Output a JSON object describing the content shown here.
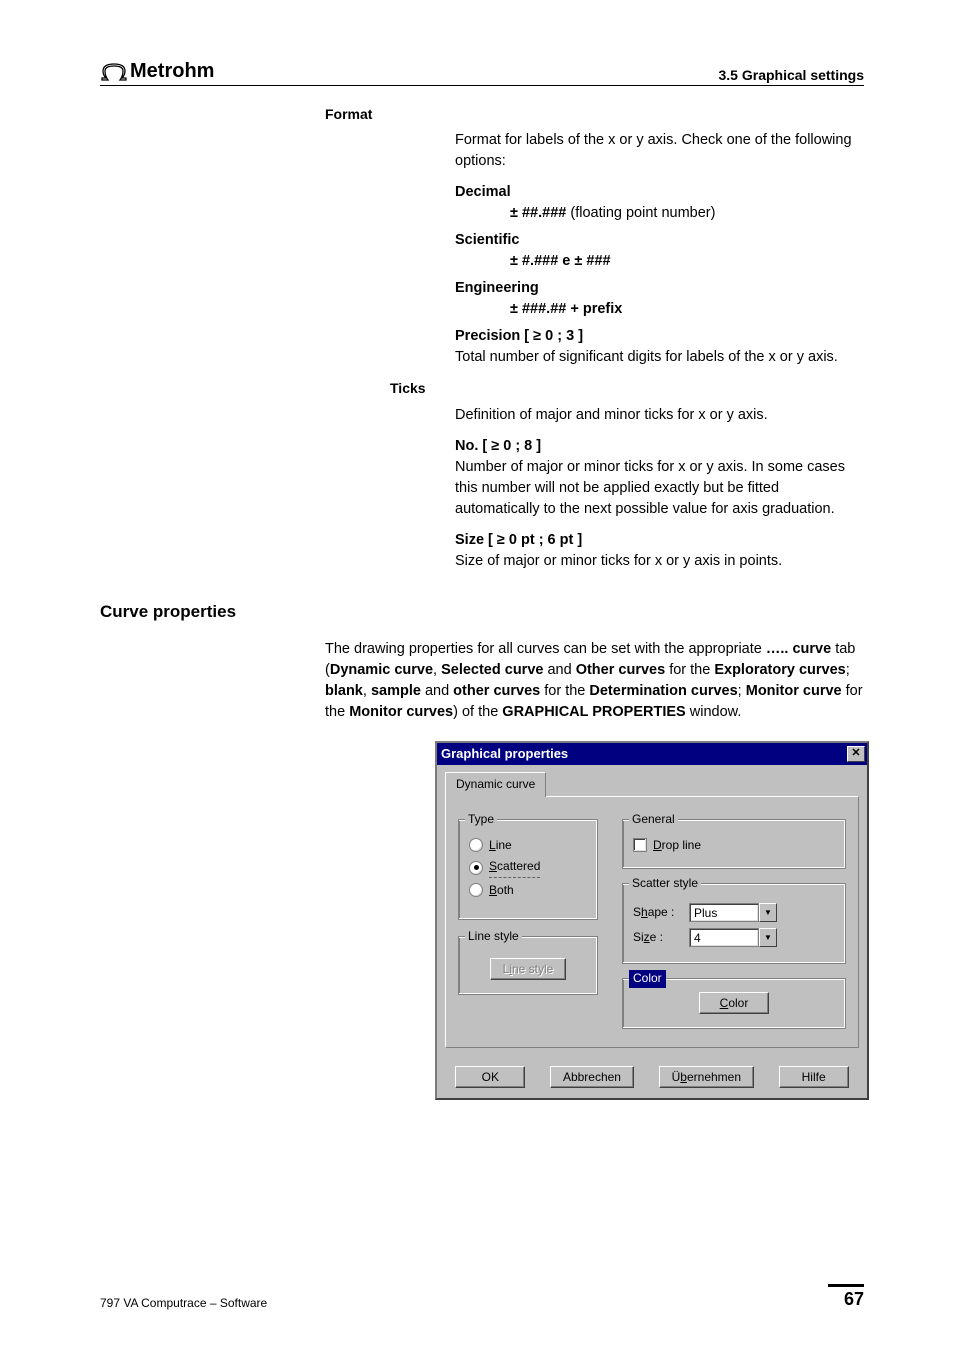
{
  "header": {
    "brand": "Metrohm",
    "section": "3.5  Graphical settings"
  },
  "format": {
    "heading": "Format",
    "intro": "Format for labels of the x or y axis. Check one of the following options:",
    "decimal_label": "Decimal",
    "decimal_fmt": "± ##.### (floating point number)",
    "scientific_label": "Scientific",
    "scientific_fmt": "± #.### e ± ###",
    "engineering_label": "Engineering",
    "engineering_fmt": "± ###.## + prefix",
    "precision_label": "Precision   [ ≥ 0 ; 3 ]",
    "precision_desc": "Total number of significant digits for labels of the x or y axis."
  },
  "ticks": {
    "heading": "Ticks",
    "intro": "Definition of major and minor ticks for x or y axis.",
    "no_label": "No.   [ ≥ 0 ; 8 ]",
    "no_desc": "Number of major or minor ticks for x or y axis. In some cases this number will not be applied exactly but be fitted automatically to the next possible value for axis graduation.",
    "size_label": "Size   [ ≥ 0 pt ; 6 pt ]",
    "size_desc": "Size of major or minor ticks for x or y axis in points."
  },
  "curve": {
    "title": "Curve properties",
    "para_pre": "The drawing properties for all curves can be set with the appropriate ",
    "dots": "…..",
    "curve_word": " curve",
    "tab_word": " tab (",
    "dynamic": "Dynamic curve",
    "sep1": ", ",
    "selected": "Selected curve",
    "and1": " and ",
    "other": "Other curves",
    "for1": " for the ",
    "explor": "Exploratory curves",
    "sep2": "; ",
    "blank": "blank",
    "sep3": ", ",
    "sample": "sample",
    "and2": " and ",
    "other2": "other curves",
    "for2": " for the ",
    "determ": "Determination curves",
    "sep4": "; ",
    "monitor": "Monitor curve",
    "for3": " for the ",
    "monitors": "Monitor curves",
    "close": ") of the ",
    "graphprop": "GRAPHICAL PROPERTIES",
    "window_word": " window."
  },
  "dialog": {
    "title": "Graphical properties",
    "tab": "Dynamic curve",
    "type_legend": "Type",
    "type_line": "Line",
    "type_scattered": "Scattered",
    "type_both": "Both",
    "linestyle_legend": "Line style",
    "linestyle_btn": "Line style",
    "general_legend": "General",
    "dropline": "Drop line",
    "scatter_legend": "Scatter style",
    "shape_label": "Shape :",
    "shape_value": "Plus",
    "size_label": "Size :",
    "size_value": "4",
    "color_legend": "Color",
    "color_btn": "Color",
    "ok": "OK",
    "cancel": "Abbrechen",
    "apply": "Übernehmen",
    "help": "Hilfe"
  },
  "footer": {
    "left": "797 VA Computrace – Software",
    "page": "67"
  }
}
